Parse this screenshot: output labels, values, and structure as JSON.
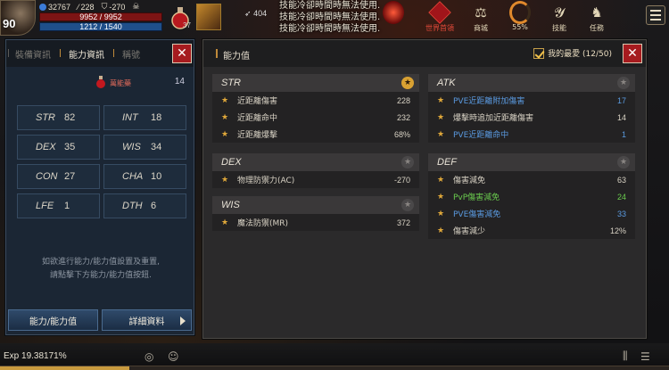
{
  "hud": {
    "level": "90",
    "currency_blue": "32767",
    "stat_a": "228",
    "stat_b": "-270",
    "hp": "9952 / 9952",
    "mp": "1212 / 1540",
    "potion_count": "37",
    "cast_count": "404",
    "system_messages": [
      "技能冷卻時間時無法使用.",
      "技能冷卻時間時無法使用.",
      "技能冷卻時間時無法使用."
    ]
  },
  "top_menu": {
    "world_boss_label": "世界首領",
    "shop_label": "商城",
    "progress_label": "55%",
    "skill_label": "技能",
    "quest_label": "任務"
  },
  "left_panel": {
    "tabs": [
      "裝備資訊",
      "能力資訊",
      "稱號"
    ],
    "bonus_label": "萬能藥",
    "bonus_value": "14",
    "stats": [
      {
        "key": "STR",
        "value": "82"
      },
      {
        "key": "INT",
        "value": "18"
      },
      {
        "key": "DEX",
        "value": "35"
      },
      {
        "key": "WIS",
        "value": "34"
      },
      {
        "key": "CON",
        "value": "27"
      },
      {
        "key": "CHA",
        "value": "10"
      },
      {
        "key": "LFE",
        "value": "1"
      },
      {
        "key": "DTH",
        "value": "6"
      }
    ],
    "hint_line1": "如欲進行能力/能力值設置及重置,",
    "hint_line2": "請點擊下方能力/能力值按鈕.",
    "btn_ability": "能力/能力值",
    "btn_details": "詳細資料"
  },
  "right_panel": {
    "title": "能力值",
    "favorites_label": "我的最愛 (12/50)",
    "groups": {
      "str": {
        "name": "STR",
        "rows": [
          {
            "label": "近距離傷害",
            "value": "228"
          },
          {
            "label": "近距離命中",
            "value": "232"
          },
          {
            "label": "近距離爆擊",
            "value": "68%"
          }
        ]
      },
      "dex": {
        "name": "DEX",
        "rows": [
          {
            "label": "物理防禦力(AC)",
            "value": "-270"
          }
        ]
      },
      "wis": {
        "name": "WIS",
        "rows": [
          {
            "label": "魔法防禦(MR)",
            "value": "372"
          }
        ]
      },
      "atk": {
        "name": "ATK",
        "rows": [
          {
            "label": "PVE近距離附加傷害",
            "value": "17"
          },
          {
            "label": "爆擊時追加近距離傷害",
            "value": "14"
          },
          {
            "label": "PVE近距離命中",
            "value": "1"
          }
        ]
      },
      "def": {
        "name": "DEF",
        "rows": [
          {
            "label": "傷害減免",
            "value": "63"
          },
          {
            "label": "PvP傷害減免",
            "value": "24"
          },
          {
            "label": "PVE傷害減免",
            "value": "33"
          },
          {
            "label": "傷害減少",
            "value": "12%"
          }
        ]
      }
    }
  },
  "bottom": {
    "exp_label": "Exp 19.38171%",
    "exp_fraction": 0.1938
  },
  "colors": {
    "accent_gold": "#d9a132",
    "pve_blue": "#5a9ae0",
    "pvp_green": "#6acb4e",
    "close_red": "#a61b1f"
  }
}
